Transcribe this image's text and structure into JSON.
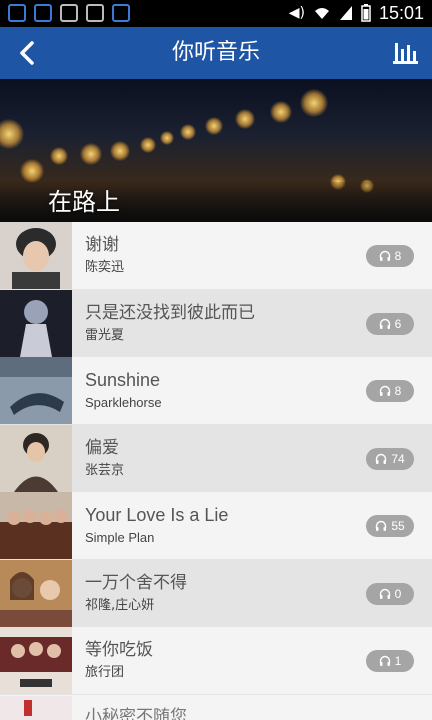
{
  "status_bar": {
    "time": "15:01"
  },
  "header": {
    "title": "你听音乐",
    "back_icon": "back-arrow-icon",
    "menu_icon": "equalizer-icon"
  },
  "banner": {
    "label": "在路上"
  },
  "songs": [
    {
      "title": "谢谢",
      "artist": "陈奕迅",
      "count": "8",
      "cover_color": "#2b2b2b"
    },
    {
      "title": "只是还没找到彼此而已",
      "artist": "雷光夏",
      "count": "6",
      "cover_color": "#1c1f2a"
    },
    {
      "title": "Sunshine",
      "artist": "Sparklehorse",
      "count": "8",
      "cover_color": "#6b7d8f"
    },
    {
      "title": "偏爱",
      "artist": "张芸京",
      "count": "74",
      "cover_color": "#4b3b32"
    },
    {
      "title": "Your Love Is a Lie",
      "artist": "Simple Plan",
      "count": "55",
      "cover_color": "#5a3020"
    },
    {
      "title": "一万个舍不得",
      "artist": "祁隆,庄心妍",
      "count": "0",
      "cover_color": "#7a4b3a"
    },
    {
      "title": "等你吃饭",
      "artist": "旅行团",
      "count": "1",
      "cover_color": "#6a2a2a"
    }
  ],
  "cut_off_song": {
    "title": "小秘密不随您"
  }
}
